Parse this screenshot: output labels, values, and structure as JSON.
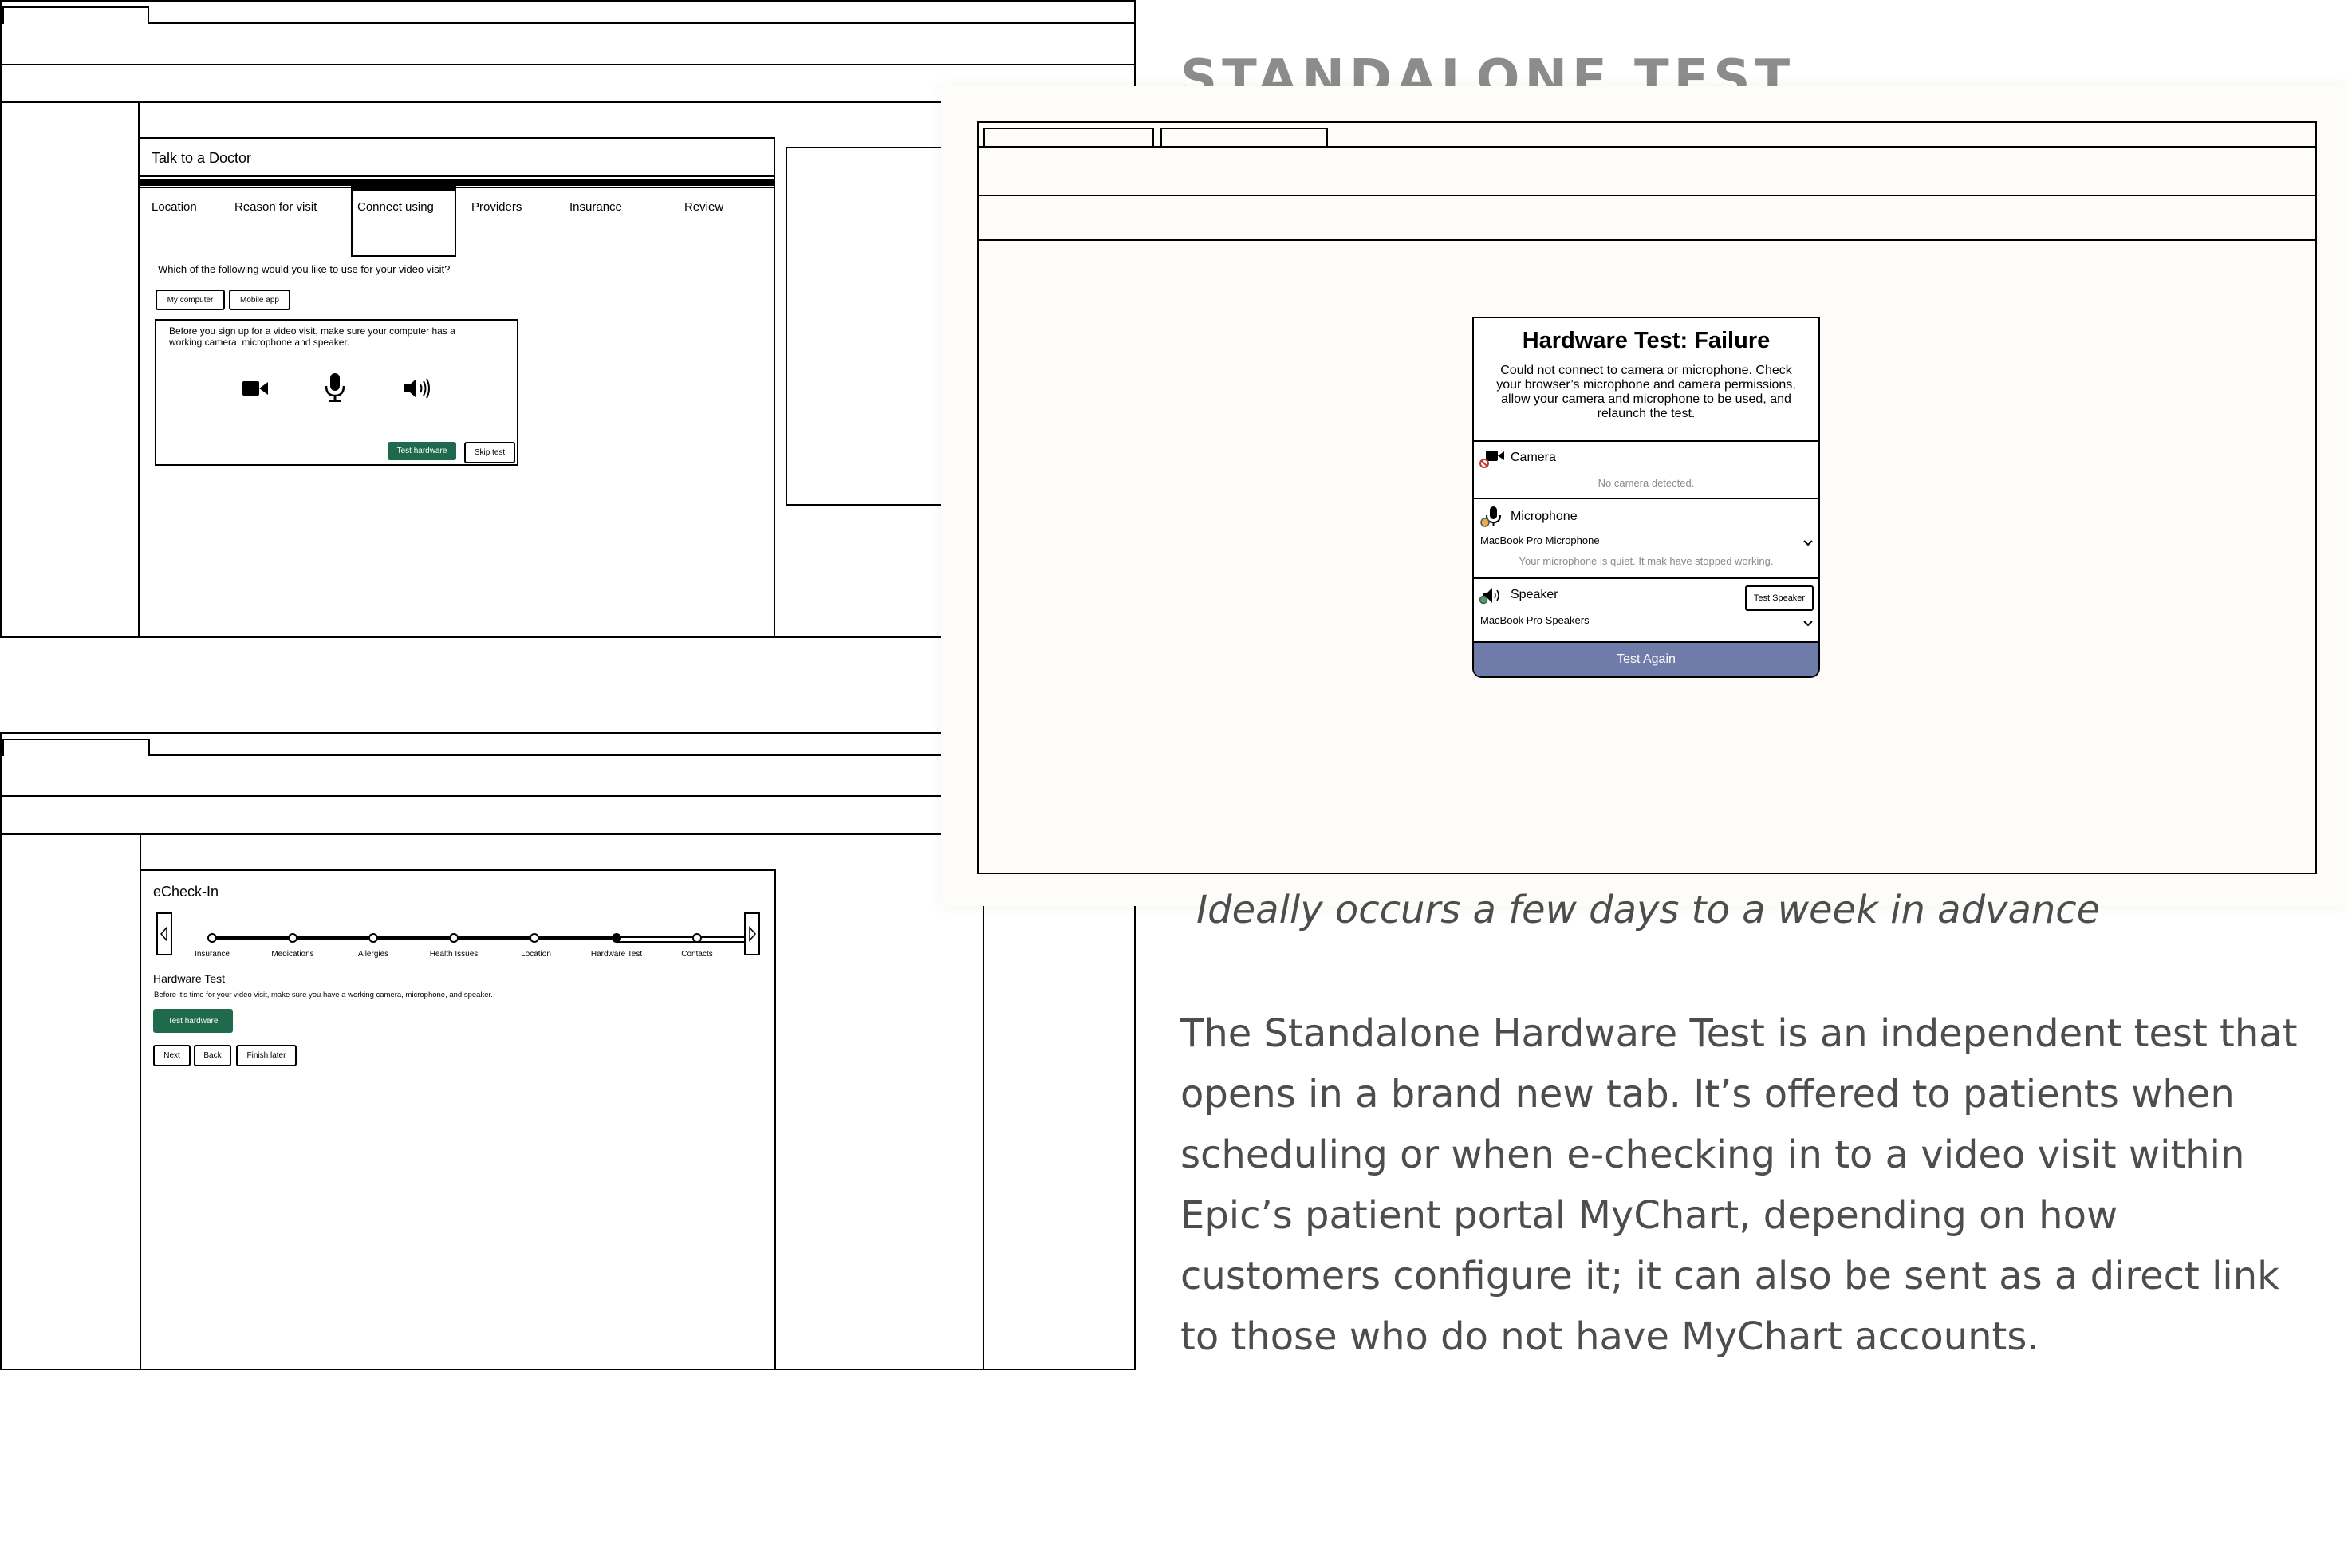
{
  "section_title": "STANDALONE TEST",
  "subtitle": "Ideally occurs a few days to a week in advance",
  "description": "The Standalone Hardware Test is an independent test that opens in a brand new tab. It’s offered to patients when scheduling or when e-checking in to a video visit within Epic’s patient portal MyChart, depending on how customers configure it; it can also be sent as a direct link to those who do not have MyChart accounts.",
  "talk_to_doctor": {
    "title": "Talk to a Doctor",
    "tabs": [
      "Location",
      "Reason for visit",
      "Connect using",
      "Providers",
      "Insurance",
      "Review"
    ],
    "active_tab": "Connect using",
    "question": "Which of the following would you like to use for your video visit?",
    "options": [
      "My computer",
      "Mobile app"
    ],
    "notice": "Before you sign up for a video visit, make sure your computer has a working camera, microphone and speaker.",
    "test_button": "Test hardware",
    "skip_button": "Skip test"
  },
  "echeckin": {
    "title": "eCheck-In",
    "steps": [
      "Insurance",
      "Medications",
      "Allergies",
      "Health Issues",
      "Location",
      "Hardware Test",
      "Contacts"
    ],
    "current_step": "Hardware Test",
    "section_heading": "Hardware Test",
    "section_text": "Before it's time for your video visit, make sure you have a working camera, microphone, and speaker.",
    "test_button": "Test hardware",
    "nav_buttons": [
      "Next",
      "Back",
      "Finish later"
    ]
  },
  "hardware_test": {
    "title": "Hardware Test: Failure",
    "message": "Could not connect to camera or microphone. Check your browser’s microphone and camera permissions, allow your camera and microphone to be used, and relaunch the test.",
    "camera_label": "Camera",
    "camera_status": "No camera detected.",
    "microphone_label": "Microphone",
    "microphone_device": "MacBook Pro Microphone",
    "microphone_status": "Your microphone is quiet. It mak have stopped working.",
    "speaker_label": "Speaker",
    "speaker_device": "MacBook Pro Speakers",
    "test_speaker_button": "Test Speaker",
    "test_again_button": "Test Again",
    "accent_color": "#6f7ba8"
  },
  "colors": {
    "button_green": "#1f6a4d",
    "text_gray": "#4d4d4d",
    "title_gray": "#8c8c8c",
    "panel_cream": "#fdfcf8"
  }
}
